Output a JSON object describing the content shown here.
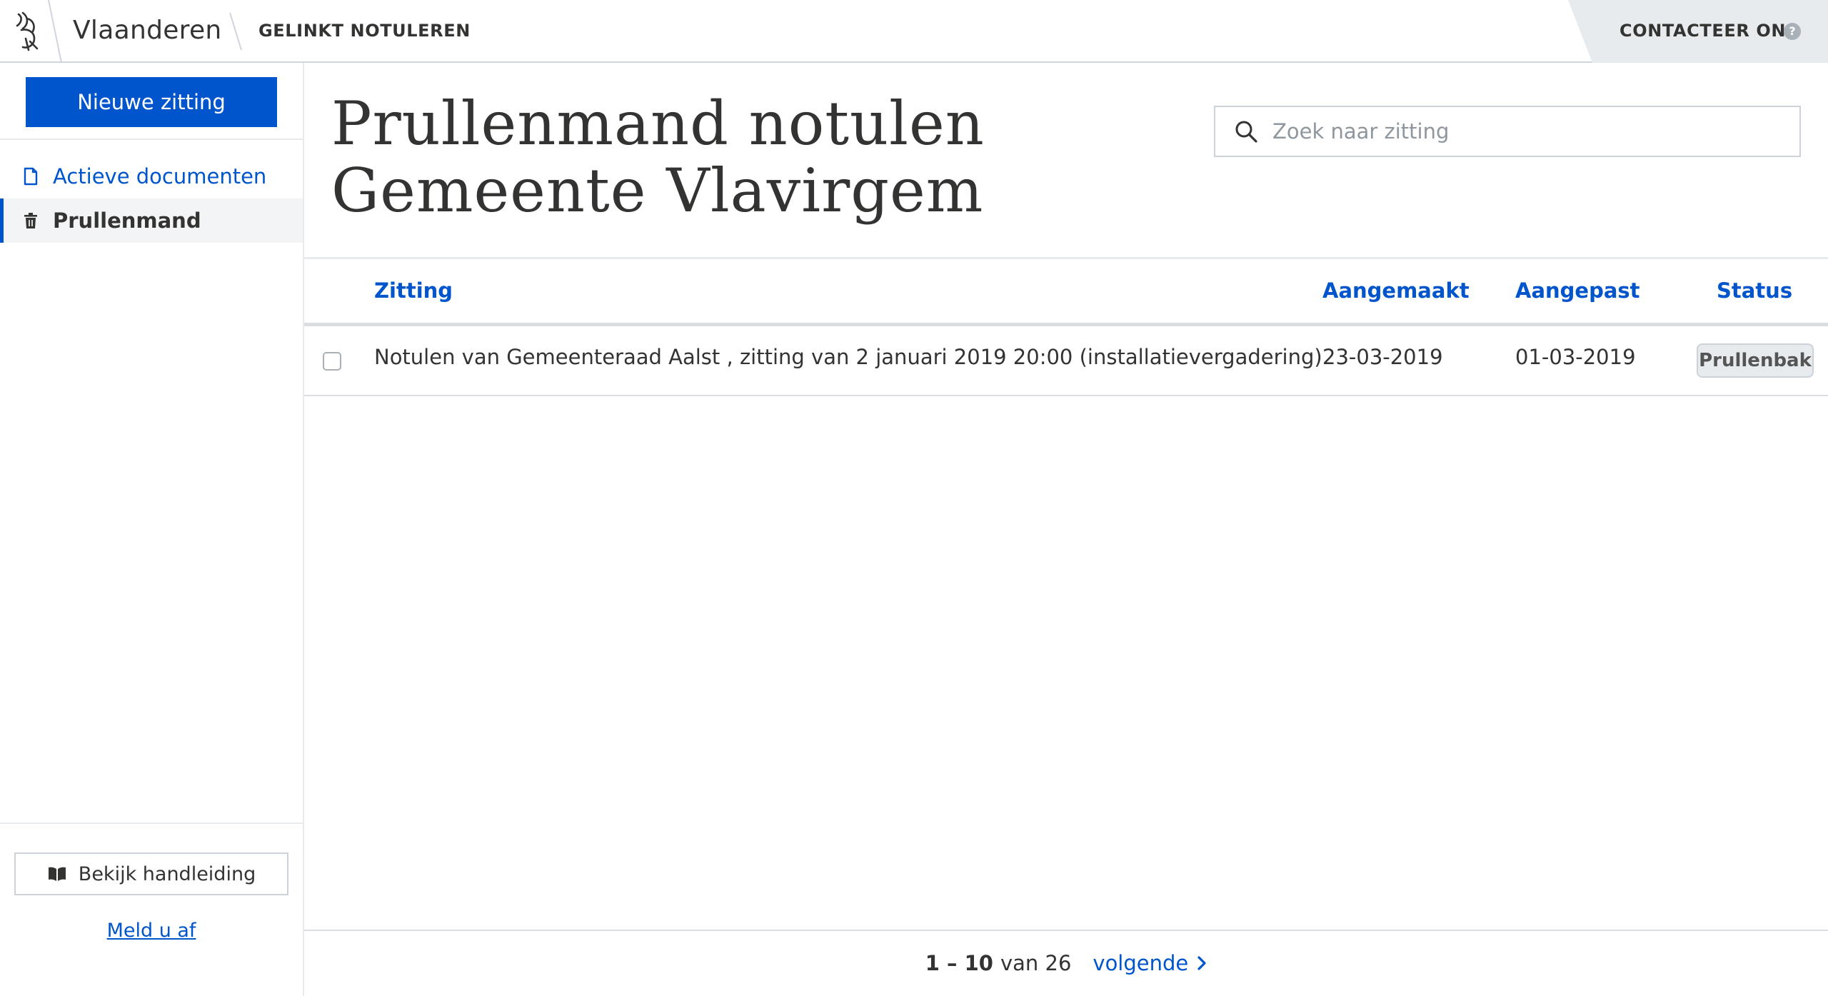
{
  "header": {
    "brand": "Vlaanderen",
    "app_name": "GELINKT NOTULEREN",
    "contact_label": "CONTACTEER ONS",
    "help_glyph": "?",
    "logo_icon": "flemish-lion-logo"
  },
  "sidebar": {
    "new_button": "Nieuwe zitting",
    "items": [
      {
        "label": "Actieve documenten",
        "icon": "document-icon",
        "active": false
      },
      {
        "label": "Prullenmand",
        "icon": "trash-icon",
        "active": true
      }
    ],
    "manual_button": "Bekijk handleiding",
    "manual_icon": "book-icon",
    "logout_link": "Meld u af"
  },
  "main": {
    "title_line1": "Prullenmand notulen",
    "title_line2": "Gemeente Vlavirgem",
    "search": {
      "placeholder": "Zoek naar zitting",
      "value": ""
    },
    "table": {
      "columns": [
        "Zitting",
        "Aangemaakt",
        "Aangepast",
        "Status"
      ],
      "rows": [
        {
          "zitting": "Notulen van Gemeenteraad Aalst , zitting van 2 januari 2019 20:00  (installatievergadering)",
          "aangemaakt": "23-03-2019",
          "aangepast": "01-03-2019",
          "status": "Prullenbak",
          "checked": false
        }
      ]
    },
    "pagination": {
      "range": "1 – 10",
      "of_label": "van 26",
      "next_label": "volgende"
    }
  },
  "colors": {
    "accent": "#0055cc",
    "text": "#333332",
    "border": "#cbd2da",
    "muted_bg": "#e8ebee"
  }
}
